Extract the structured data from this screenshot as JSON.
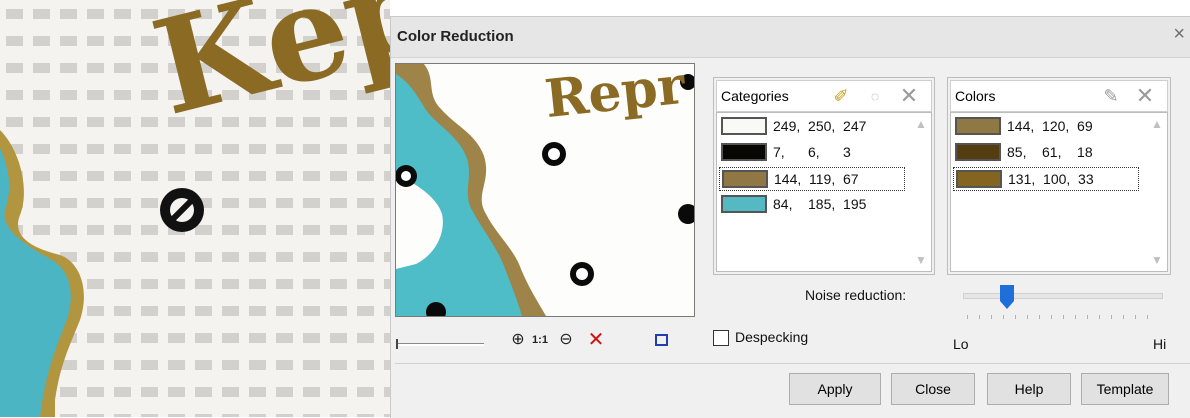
{
  "dialog": {
    "title": "Color Reduction",
    "close_glyph": "×"
  },
  "left_image": {
    "text": "Kep"
  },
  "preview": {
    "text": "Repr"
  },
  "toolbar": {
    "zoom_in_icon": "zoom-in-icon",
    "actual_size_label": "1:1",
    "zoom_out_icon": "zoom-out-icon",
    "delete_icon": "delete-icon",
    "fit_icon": "fit-window-icon"
  },
  "categories": {
    "label": "Categories",
    "rows": [
      {
        "text": "249,  250,  247",
        "color": "#f9faf7",
        "selected": false
      },
      {
        "text": "7,      6,      3",
        "color": "#070603",
        "selected": false
      },
      {
        "text": "144,  119,  67",
        "color": "#907743",
        "selected": true
      },
      {
        "text": "84,    185,  195",
        "color": "#54b9c3",
        "selected": false
      }
    ]
  },
  "colors": {
    "label": "Colors",
    "rows": [
      {
        "text": "144,  120,  69",
        "color": "#907845",
        "selected": false
      },
      {
        "text": "85,    61,    18",
        "color": "#553d12",
        "selected": false
      },
      {
        "text": "131,  100,  33",
        "color": "#836421",
        "selected": true
      }
    ]
  },
  "noise": {
    "label": "Noise reduction:",
    "lo": "Lo",
    "hi": "Hi",
    "level": 0.2
  },
  "despeckling": {
    "label": "Despecking",
    "checked": false
  },
  "buttons": {
    "apply": "Apply",
    "close": "Close",
    "help": "Help",
    "template": "Template"
  },
  "accent": "#1e6fd9"
}
